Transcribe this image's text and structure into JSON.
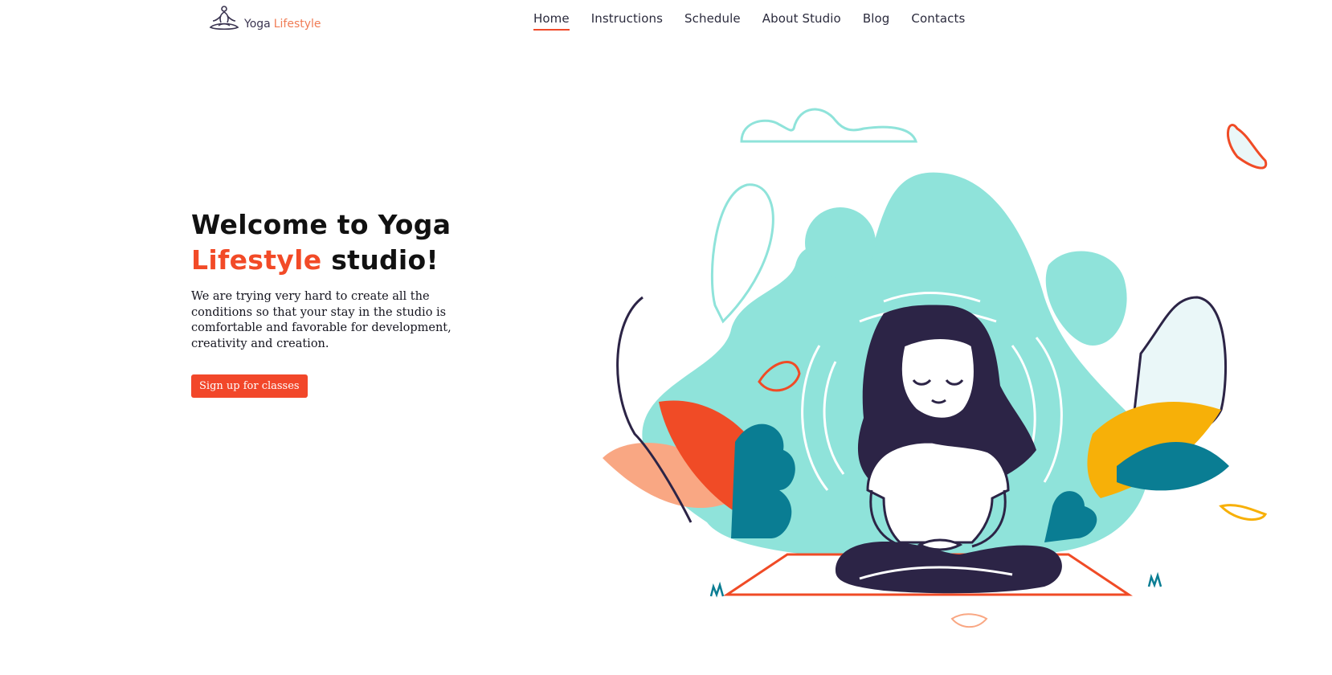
{
  "brand": {
    "word1": "Yoga",
    "word2": "Lifestyle",
    "logo_icon": "meditating-figure-icon"
  },
  "nav": {
    "items": [
      {
        "label": "Home",
        "active": true
      },
      {
        "label": "Instructions",
        "active": false
      },
      {
        "label": "Schedule",
        "active": false
      },
      {
        "label": "About Studio",
        "active": false
      },
      {
        "label": "Blog",
        "active": false
      },
      {
        "label": "Contacts",
        "active": false
      }
    ]
  },
  "hero": {
    "title_part1": "Welcome to Yoga",
    "title_accent": "Lifestyle",
    "title_part2": "studio!",
    "description": "We are trying very hard to create all the conditions so that your stay in the studio is comfortable and favorable for development, creativity and creation.",
    "cta_label": "Sign up for classes"
  },
  "colors": {
    "accent": "#f24a27",
    "teal": "#8fe3da",
    "dark_teal": "#0a7d93",
    "navy": "#2c2446",
    "orange_leaf": "#f04b26",
    "peach_leaf": "#f9a783",
    "yellow_leaf": "#f7b008"
  },
  "illustration": {
    "icon": "meditating-woman-illustration"
  }
}
